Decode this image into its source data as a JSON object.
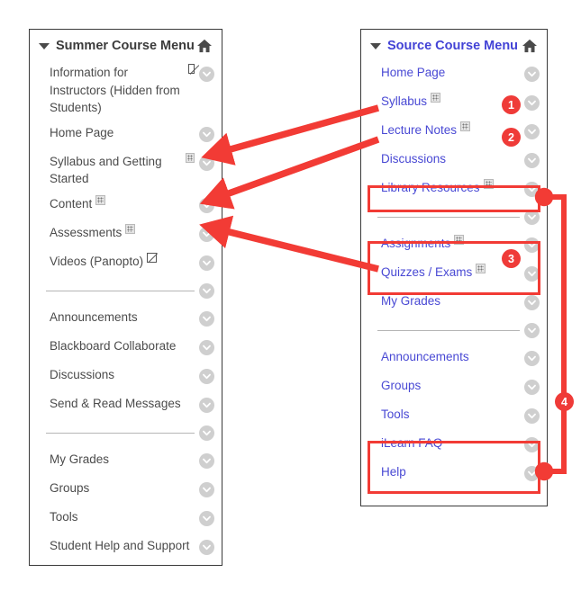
{
  "colors": {
    "annotation_red": "#f23b35",
    "badge_red": "#ef3b38",
    "source_link_blue": "#4949d4",
    "summer_text_grey": "#4b4b4b",
    "panel_border": "#3a3a3a",
    "chevron_circle_grey": "#cfcfcf"
  },
  "summer_menu": {
    "title": "Summer Course Menu",
    "caret_icon": "caret-down-icon",
    "home_icon": "home-icon",
    "items": [
      {
        "type": "link",
        "label": "Information for Instructors (Hidden from Students)",
        "glyph": "hidden-icon",
        "chevron": "chevron-down-icon"
      },
      {
        "type": "link",
        "label": "Home Page",
        "glyph": "none",
        "chevron": "chevron-down-icon"
      },
      {
        "type": "link",
        "label": "Syllabus and Getting Started",
        "glyph": "content-grid-icon",
        "chevron": "chevron-down-icon"
      },
      {
        "type": "link",
        "label": "Content",
        "glyph": "content-grid-icon",
        "chevron": "chevron-down-icon"
      },
      {
        "type": "link",
        "label": "Assessments",
        "glyph": "content-grid-icon",
        "chevron": "chevron-down-icon"
      },
      {
        "type": "link",
        "label": "Videos (Panopto)",
        "glyph": "hidden-icon",
        "chevron": "chevron-down-icon"
      },
      {
        "type": "divider",
        "label": "",
        "glyph": "none",
        "chevron": "chevron-down-icon"
      },
      {
        "type": "link",
        "label": "Announcements",
        "glyph": "none",
        "chevron": "chevron-down-icon"
      },
      {
        "type": "link",
        "label": "Blackboard Collaborate",
        "glyph": "none",
        "chevron": "chevron-down-icon"
      },
      {
        "type": "link",
        "label": "Discussions",
        "glyph": "none",
        "chevron": "chevron-down-icon"
      },
      {
        "type": "link",
        "label": "Send & Read Messages",
        "glyph": "none",
        "chevron": "chevron-down-icon"
      },
      {
        "type": "divider",
        "label": "",
        "glyph": "none",
        "chevron": "chevron-down-icon"
      },
      {
        "type": "link",
        "label": "My Grades",
        "glyph": "none",
        "chevron": "chevron-down-icon"
      },
      {
        "type": "link",
        "label": "Groups",
        "glyph": "none",
        "chevron": "chevron-down-icon"
      },
      {
        "type": "link",
        "label": "Tools",
        "glyph": "none",
        "chevron": "chevron-down-icon"
      },
      {
        "type": "link",
        "label": "Student Help and Support",
        "glyph": "none",
        "chevron": "chevron-down-icon"
      }
    ]
  },
  "source_menu": {
    "title": "Source Course Menu",
    "caret_icon": "caret-down-icon",
    "home_icon": "home-icon",
    "items": [
      {
        "type": "link",
        "label": "Home Page",
        "glyph": "none",
        "chevron": "chevron-down-icon"
      },
      {
        "type": "link",
        "label": "Syllabus",
        "glyph": "content-grid-icon",
        "chevron": "chevron-down-icon"
      },
      {
        "type": "link",
        "label": "Lecture Notes",
        "glyph": "content-grid-icon",
        "chevron": "chevron-down-icon"
      },
      {
        "type": "link",
        "label": "Discussions",
        "glyph": "none",
        "chevron": "chevron-down-icon"
      },
      {
        "type": "link",
        "label": "Library Resources",
        "glyph": "content-grid-icon",
        "chevron": "chevron-down-icon"
      },
      {
        "type": "divider",
        "label": "",
        "glyph": "none",
        "chevron": "chevron-down-icon"
      },
      {
        "type": "link",
        "label": "Assignments",
        "glyph": "content-grid-icon",
        "chevron": "chevron-down-icon"
      },
      {
        "type": "link",
        "label": "Quizzes / Exams",
        "glyph": "content-grid-icon",
        "chevron": "chevron-down-icon"
      },
      {
        "type": "link",
        "label": "My Grades",
        "glyph": "none",
        "chevron": "chevron-down-icon"
      },
      {
        "type": "divider",
        "label": "",
        "glyph": "none",
        "chevron": "chevron-down-icon"
      },
      {
        "type": "link",
        "label": "Announcements",
        "glyph": "none",
        "chevron": "chevron-down-icon"
      },
      {
        "type": "link",
        "label": "Groups",
        "glyph": "none",
        "chevron": "chevron-down-icon"
      },
      {
        "type": "link",
        "label": "Tools",
        "glyph": "none",
        "chevron": "chevron-down-icon"
      },
      {
        "type": "link",
        "label": "iLearn FAQ",
        "glyph": "none",
        "chevron": "chevron-down-icon"
      },
      {
        "type": "link",
        "label": "Help",
        "glyph": "none",
        "chevron": "chevron-down-icon"
      }
    ]
  },
  "annotations": {
    "badges": [
      {
        "number": "1",
        "refers_to": "Syllabus"
      },
      {
        "number": "2",
        "refers_to": "Lecture Notes"
      },
      {
        "number": "3",
        "refers_to": "Assignments / Quizzes / Exams"
      },
      {
        "number": "4",
        "refers_to": "Library Resources to iLearn FAQ / Help"
      }
    ],
    "arrows": [
      {
        "from": "Syllabus",
        "to": "Syllabus and Getting Started"
      },
      {
        "from": "Lecture Notes",
        "to": "Content"
      },
      {
        "from": "Assignments / Quizzes / Exams",
        "to": "Assessments"
      }
    ],
    "highlight_boxes": [
      {
        "label": "Library Resources"
      },
      {
        "label": "Assignments / Quizzes / Exams"
      },
      {
        "label": "iLearn FAQ / Help"
      }
    ]
  }
}
